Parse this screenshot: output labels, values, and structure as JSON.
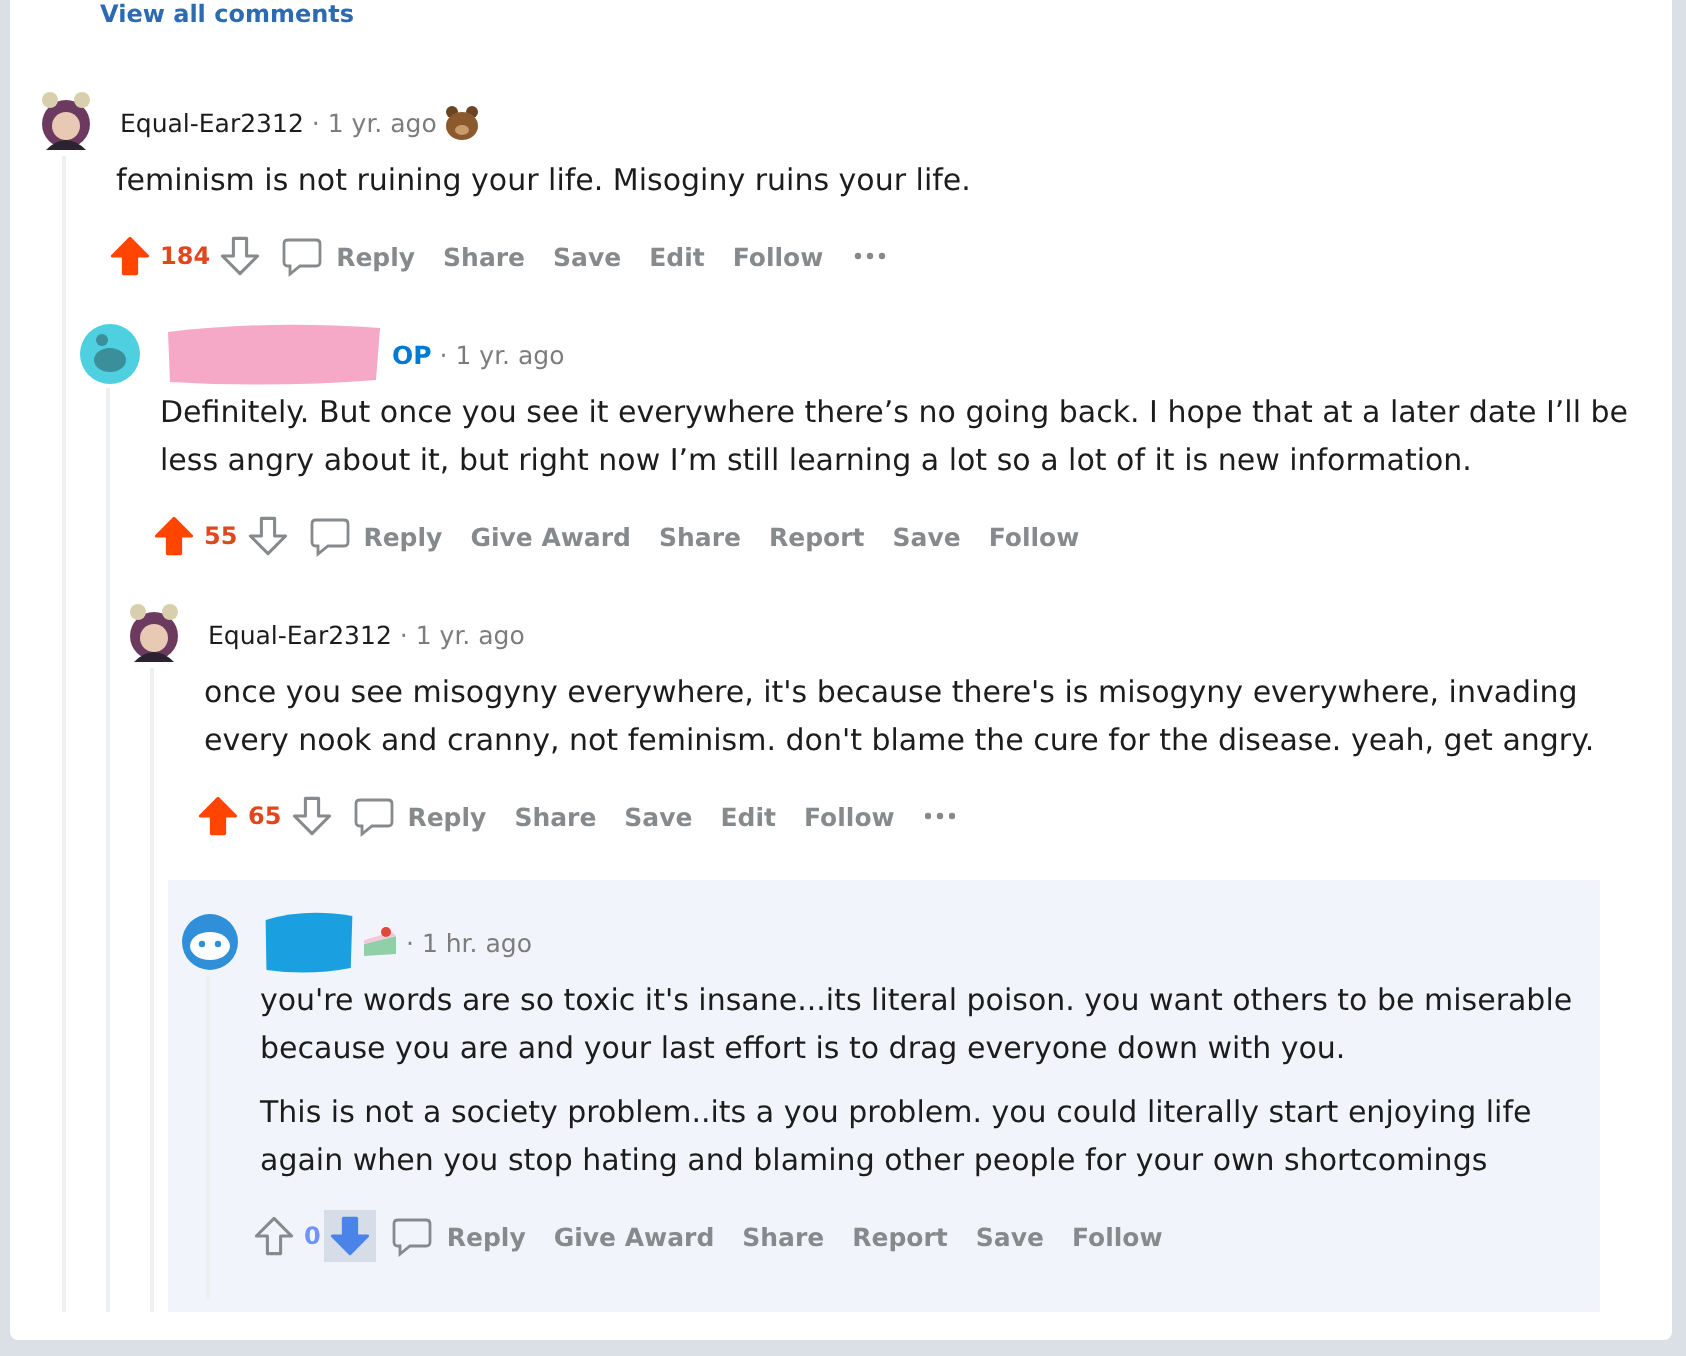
{
  "view_all_link": "View all comments",
  "comments": [
    {
      "avatar": {
        "kind": "figure"
      },
      "author": "Equal-Ear2312",
      "flair": {
        "kind": "bear"
      },
      "time": "· 1 yr. ago",
      "paragraphs": [
        "feminism is not ruining your life. Misoginy ruins your life."
      ],
      "score": "184",
      "upvoted": true,
      "downvoted": false,
      "actions": [
        "Reply",
        "Share",
        "Save",
        "Edit",
        "Follow"
      ],
      "more": true,
      "children": [
        {
          "avatar": {
            "kind": "robot"
          },
          "redaction": {
            "color": "#f5a9c7"
          },
          "op_label": "OP",
          "time": "· 1 yr. ago",
          "paragraphs": [
            "Definitely. But once you see it everywhere there’s no going back. I hope that at a later date I’ll be less angry about it, but right now I’m still learning a lot so a lot of it is new information."
          ],
          "score": "55",
          "upvoted": true,
          "downvoted": false,
          "actions": [
            "Reply",
            "Give Award",
            "Share",
            "Report",
            "Save",
            "Follow"
          ],
          "children": [
            {
              "avatar": {
                "kind": "figure"
              },
              "author": "Equal-Ear2312",
              "time": "· 1 yr. ago",
              "paragraphs": [
                "once you see misogyny everywhere, it's because there's is misogyny everywhere, invading every nook and cranny, not feminism. don't blame the cure for the disease. yeah, get angry."
              ],
              "score": "65",
              "upvoted": true,
              "downvoted": false,
              "actions": [
                "Reply",
                "Share",
                "Save",
                "Edit",
                "Follow"
              ],
              "more": true,
              "children": [
                {
                  "avatar": {
                    "kind": "snoo"
                  },
                  "redaction": {
                    "color": "#1a9fe0"
                  },
                  "flair": {
                    "kind": "cake"
                  },
                  "time": "· 1 hr. ago",
                  "highlighted": true,
                  "paragraphs": [
                    "you're words are so toxic it's insane...its literal poison. you want others to be miserable because you are and your last effort is to drag everyone down with you.",
                    "This is not a society problem..its a you problem. you could literally start enjoying life again when you stop hating and blaming other people for your own shortcomings"
                  ],
                  "score": "0",
                  "upvoted": false,
                  "downvoted": true,
                  "actions": [
                    "Reply",
                    "Give Award",
                    "Share",
                    "Report",
                    "Save",
                    "Follow"
                  ]
                }
              ]
            }
          ]
        }
      ]
    }
  ]
}
